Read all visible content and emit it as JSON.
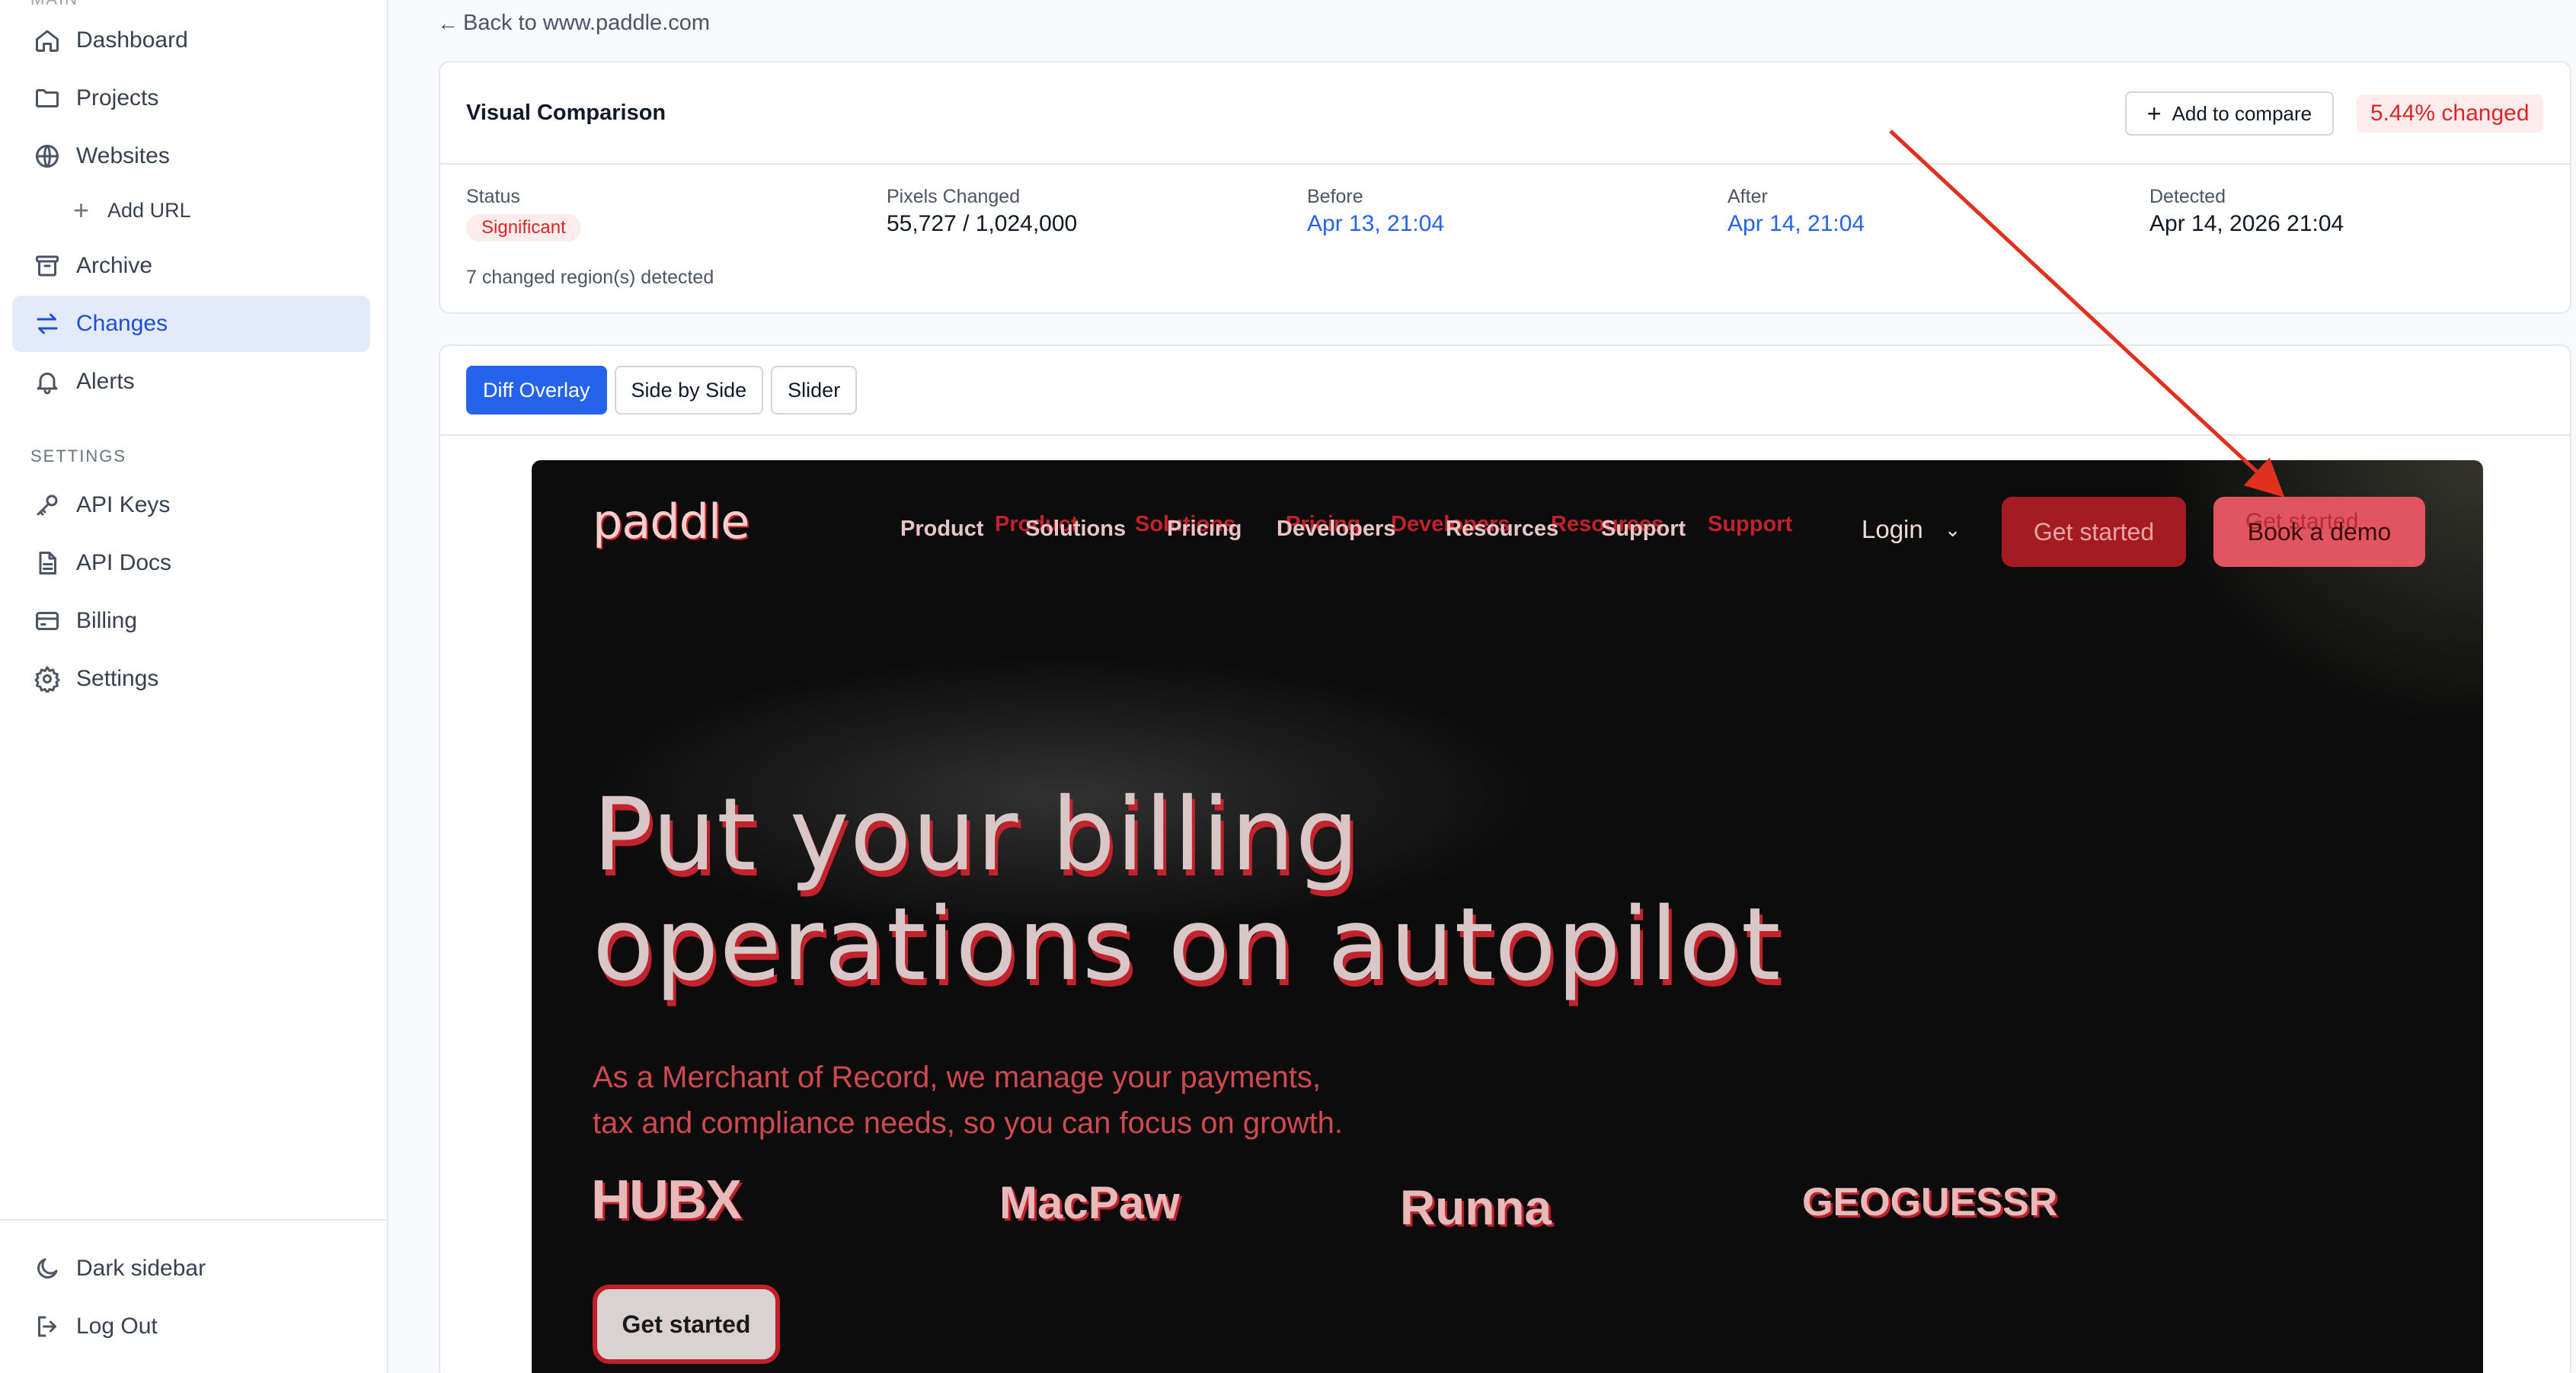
{
  "sidebar": {
    "top_cut": "MAIN",
    "items": [
      {
        "label": "Dashboard",
        "icon": "home-icon"
      },
      {
        "label": "Projects",
        "icon": "folder-icon"
      },
      {
        "label": "Websites",
        "icon": "globe-icon"
      },
      {
        "label": "Archive",
        "icon": "archive-icon"
      },
      {
        "label": "Changes",
        "icon": "arrows-swap-icon"
      },
      {
        "label": "Alerts",
        "icon": "bell-icon"
      }
    ],
    "add_url": "Add URL",
    "settings_label": "SETTINGS",
    "settings_items": [
      {
        "label": "API Keys",
        "icon": "key-icon"
      },
      {
        "label": "API Docs",
        "icon": "document-icon"
      },
      {
        "label": "Billing",
        "icon": "credit-card-icon"
      },
      {
        "label": "Settings",
        "icon": "gear-icon"
      }
    ],
    "dark_sidebar": "Dark sidebar",
    "log_out": "Log Out"
  },
  "back_link": "Back to www.paddle.com",
  "summary": {
    "title": "Visual Comparison",
    "add_to_compare": "Add to compare",
    "changed_percent": "5.44% changed",
    "status_label": "Status",
    "status_value": "Significant",
    "pixels_label": "Pixels Changed",
    "pixels_value": "55,727 / 1,024,000",
    "before_label": "Before",
    "before_value": "Apr 13, 21:04",
    "after_label": "After",
    "after_value": "Apr 14, 21:04",
    "detected_label": "Detected",
    "detected_value": "Apr 14, 2026 21:04",
    "regions": "7 changed region(s) detected"
  },
  "tabs": [
    "Diff Overlay",
    "Side by Side",
    "Slider"
  ],
  "preview": {
    "logo": "paddle",
    "nav": [
      "Product",
      "Solutions",
      "Pricing",
      "Developers",
      "Resources",
      "Support"
    ],
    "nav_ghost": [
      "Product",
      "Solutions",
      "Pricing",
      "Developers",
      "Resources",
      "Support"
    ],
    "login": "Login",
    "get_started": "Get started",
    "book_demo": "Book a demo",
    "book_demo_ghost": "Get started",
    "hero_line1": "Put your billing",
    "hero_line2": "operations on autopilot",
    "sub_line1": "As a Merchant of Record, we manage your payments,",
    "sub_line2": "tax and compliance needs, so you can focus on growth.",
    "logos": [
      "HUBX",
      "MacPaw",
      "Runna",
      "GEOGUESSR"
    ],
    "cta": "Get started"
  },
  "colors": {
    "accent": "#2563eb",
    "danger": "#dc2626",
    "arrow": "#e0301e"
  }
}
